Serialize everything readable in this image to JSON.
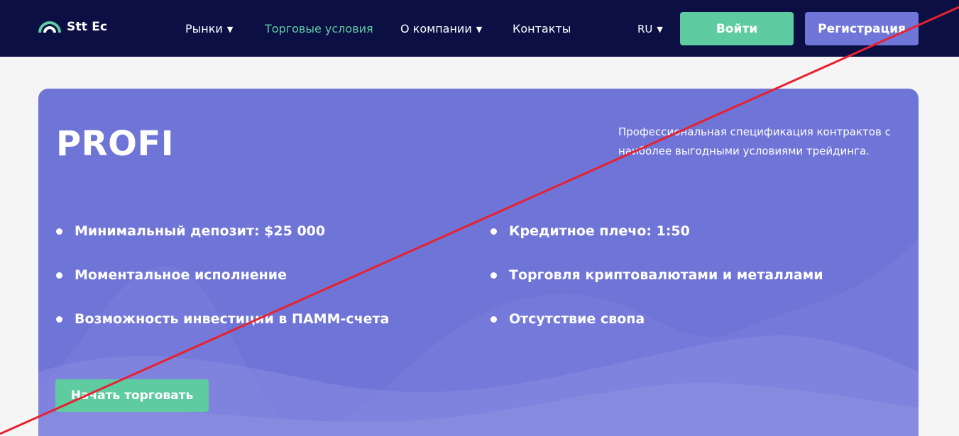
{
  "header": {
    "brand": "Stt Ec",
    "nav": [
      {
        "label": "Рынки",
        "has_dropdown": true,
        "active": false
      },
      {
        "label": "Торговые условия",
        "has_dropdown": false,
        "active": true
      },
      {
        "label": "О компании",
        "has_dropdown": true,
        "active": false
      },
      {
        "label": "Контакты",
        "has_dropdown": false,
        "active": false
      }
    ],
    "language": "RU",
    "login_label": "Войти",
    "register_label": "Регистрация"
  },
  "plan": {
    "title": "PROFI",
    "description": "Профессиональная спецификация контрактов с наиболее выгодными условиями трейдинга.",
    "features_left": [
      "Минимальный депозит: $25 000",
      "Моментальное исполнение",
      "Возможность инвестиций в ПАММ-счета"
    ],
    "features_right": [
      "Кредитное плечо: 1:50",
      "Торговля криптовалютами и металлами",
      "Отсутствие свопа"
    ],
    "cta_label": "Начать торговать"
  },
  "colors": {
    "header_bg": "#0b0f44",
    "accent_green": "#5ecba1",
    "accent_purple": "#7076d8",
    "card_bg": "#6f74d7",
    "strike_red": "#e8212f"
  },
  "icons": {
    "logo": "semicircle-arcs-logo-icon",
    "dropdown": "caret-down-icon"
  }
}
